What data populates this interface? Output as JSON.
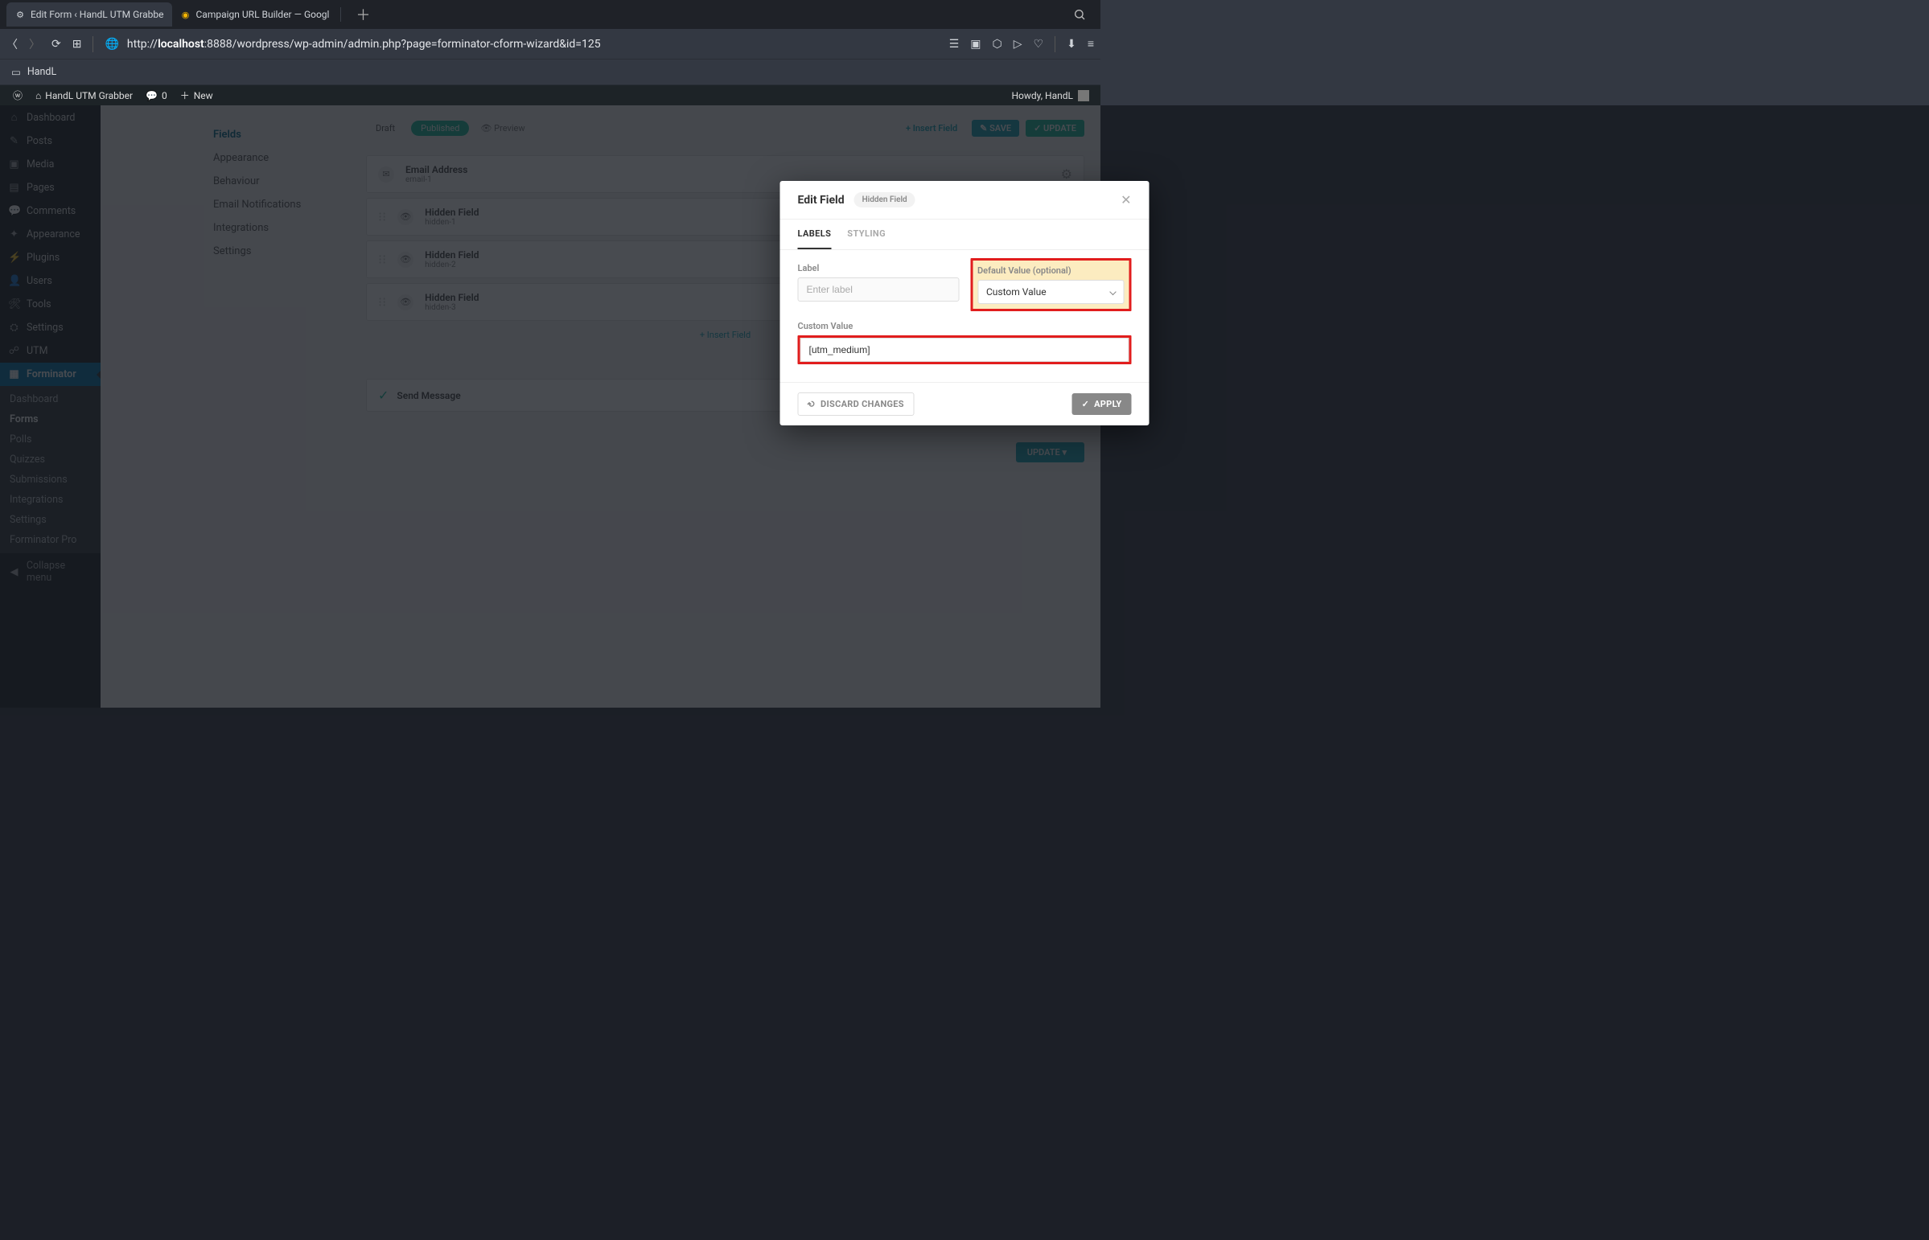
{
  "browser": {
    "tabs": [
      {
        "favicon": "⚙",
        "title": "Edit Form ‹ HandL UTM Grabbe",
        "active": true
      },
      {
        "favicon": "◉",
        "title": "Campaign URL Builder — Googl",
        "active": false
      }
    ],
    "url_prefix": "http://",
    "url_host": "localhost",
    "url_rest": ":8888/wordpress/wp-admin/admin.php?page=forminator-cform-wizard&id=125",
    "bookmark": "HandL"
  },
  "wp_bar": {
    "site": "HandL UTM Grabber",
    "comments": "0",
    "new": "New",
    "howdy": "Howdy, HandL"
  },
  "wp_menu": {
    "items": [
      {
        "icon": "⌂",
        "label": "Dashboard"
      },
      {
        "icon": "✎",
        "label": "Posts"
      },
      {
        "icon": "▣",
        "label": "Media"
      },
      {
        "icon": "▤",
        "label": "Pages"
      },
      {
        "icon": "💬",
        "label": "Comments"
      },
      {
        "icon": "✦",
        "label": "Appearance"
      },
      {
        "icon": "⚡",
        "label": "Plugins"
      },
      {
        "icon": "👤",
        "label": "Users"
      },
      {
        "icon": "🛠",
        "label": "Tools"
      },
      {
        "icon": "⛭",
        "label": "Settings"
      },
      {
        "icon": "☍",
        "label": "UTM"
      },
      {
        "icon": "▦",
        "label": "Forminator",
        "active": true
      }
    ],
    "submenu": [
      "Dashboard",
      "Forms",
      "Polls",
      "Quizzes",
      "Submissions",
      "Integrations",
      "Settings",
      "Forminator Pro"
    ],
    "submenu_current": "Forms",
    "collapse": "Collapse menu"
  },
  "bg": {
    "side": [
      "Fields",
      "Appearance",
      "Behaviour",
      "Email Notifications",
      "Integrations",
      "Settings"
    ],
    "side_active": "Fields",
    "status_pill": "Published",
    "draft": "Draft",
    "preview": "Preview",
    "save": "SAVE",
    "update": "UPDATE",
    "insert": "+ Insert Field",
    "fields": [
      {
        "title": "Email Address",
        "sub": "email-1"
      },
      {
        "title": "Hidden Field",
        "sub": "hidden-1"
      },
      {
        "title": "Hidden Field",
        "sub": "hidden-2"
      },
      {
        "title": "Hidden Field",
        "sub": "hidden-3"
      }
    ],
    "submit": "Send Message",
    "update_bottom": "UPDATE"
  },
  "modal": {
    "title": "Edit Field",
    "badge": "Hidden Field",
    "tabs": [
      "LABELS",
      "STYLING"
    ],
    "tab_active": "LABELS",
    "label_field_label": "Label",
    "label_placeholder": "Enter label",
    "default_value_label": "Default Value (optional)",
    "default_value_selected": "Custom Value",
    "custom_value_label": "Custom Value",
    "custom_value": "[utm_medium]",
    "discard": "DISCARD CHANGES",
    "apply": "APPLY"
  }
}
